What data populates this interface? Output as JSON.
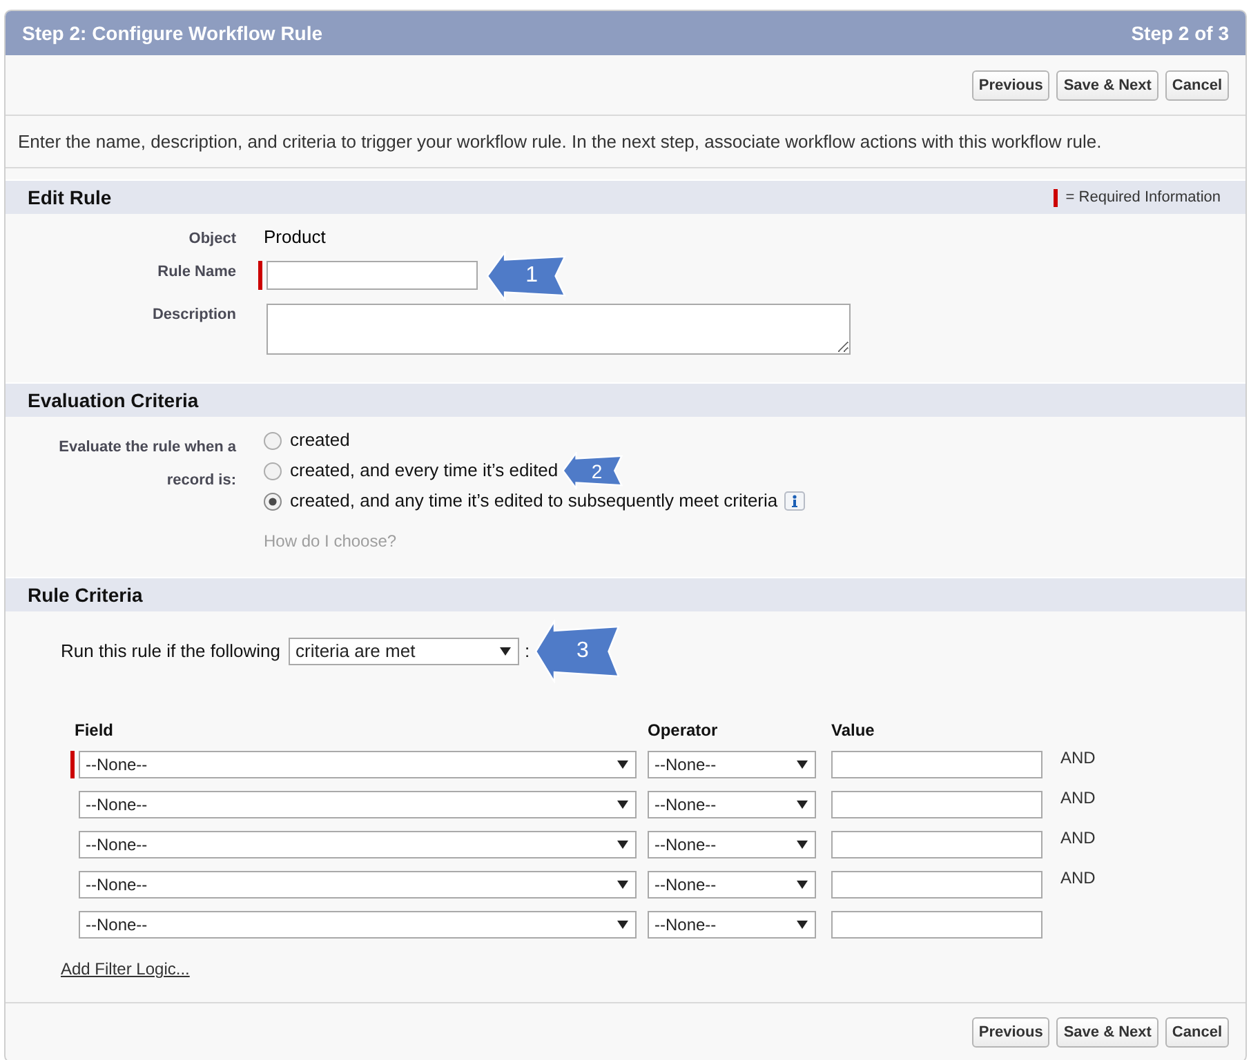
{
  "header": {
    "title": "Step 2: Configure Workflow Rule",
    "step": "Step 2 of 3"
  },
  "top_buttons": [
    "Previous",
    "Save & Next",
    "Cancel"
  ],
  "instructions": "Enter the name, description, and criteria to trigger your workflow rule. In the next step, associate workflow actions with this workflow rule.",
  "edit_rule": {
    "title": "Edit Rule",
    "required_legend": "= Required Information",
    "fields": [
      {
        "kind": "text",
        "label": "Object",
        "value": "Product"
      },
      {
        "kind": "input",
        "label": "Rule Name",
        "required": true,
        "callout": "1"
      },
      {
        "kind": "textarea",
        "label": "Description",
        "required": false
      }
    ]
  },
  "evaluation_criteria": {
    "title": "Evaluation Criteria",
    "label": "Evaluate the rule when a record is:",
    "options": [
      {
        "label": "created",
        "selected": false
      },
      {
        "label": "created, and every time it’s edited",
        "selected": false,
        "callout": "2"
      },
      {
        "label": "created, and any time it’s edited to subsequently meet criteria",
        "selected": true
      }
    ],
    "help_link": "How do I choose?"
  },
  "rule_criteria": {
    "title": "Rule Criteria",
    "run_label": "Run this rule if the following",
    "run_select": "criteria are met",
    "run_suffix": ":",
    "callout": "3",
    "columns": [
      "Field",
      "Operator",
      "Value"
    ],
    "rows": [
      {
        "field": "--None--",
        "operator": "--None--",
        "required": true,
        "connector": "AND"
      },
      {
        "field": "--None--",
        "operator": "--None--",
        "required": false,
        "connector": "AND"
      },
      {
        "field": "--None--",
        "operator": "--None--",
        "required": false,
        "connector": "AND"
      },
      {
        "field": "--None--",
        "operator": "--None--",
        "required": false,
        "connector": "AND"
      },
      {
        "field": "--None--",
        "operator": "--None--",
        "required": false
      }
    ],
    "add_filter_logic": "Add Filter Logic..."
  },
  "bottom_buttons": [
    "Previous",
    "Save & Next",
    "Cancel"
  ]
}
